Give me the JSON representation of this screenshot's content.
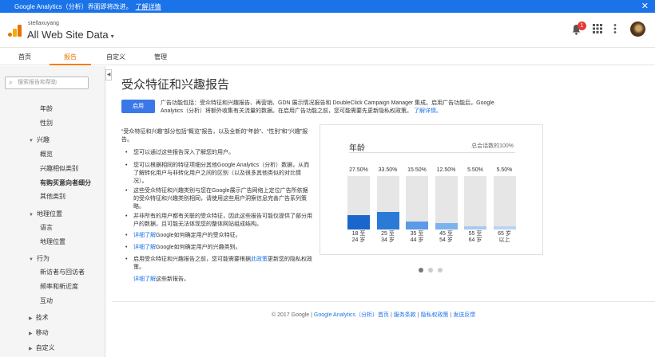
{
  "banner": {
    "text": "Google Analytics（分析）界面即将改进。",
    "link": "了解详情",
    "close": "✕"
  },
  "header": {
    "account": "stellaxuyang",
    "property": "All Web Site Data",
    "property_caret": "▾",
    "notification_count": "1",
    "icons": {
      "bell": "bell-icon",
      "apps": "apps-grid-icon",
      "more": "more-vert-icon"
    }
  },
  "tabs": [
    {
      "label": "首页"
    },
    {
      "label": "报告"
    },
    {
      "label": "自定义"
    },
    {
      "label": "管理"
    }
  ],
  "sidebar": {
    "search_placeholder": "搜索报告和帮助",
    "items": [
      {
        "label": "年龄"
      },
      {
        "label": "性别"
      },
      {
        "label": "兴趣"
      },
      {
        "label": "概览"
      },
      {
        "label": "兴趣相似类别"
      },
      {
        "label": "有购买意向者细分"
      },
      {
        "label": "其他类别"
      },
      {
        "label": "地理位置"
      },
      {
        "label": "语言"
      },
      {
        "label": "地理位置"
      },
      {
        "label": "行为"
      },
      {
        "label": "新访者与回访者"
      },
      {
        "label": "频率和新近度"
      },
      {
        "label": "互动"
      },
      {
        "label": "技术"
      },
      {
        "label": "移动"
      },
      {
        "label": "自定义"
      }
    ]
  },
  "main": {
    "title": "受众特征和兴趣报告",
    "enable_button": "启用",
    "ad_text_line1": "广告功能包括：受众特征和兴趣报告、再营销、GDN 展示情况报告和 DoubleClick Campaign Manager 集成。启用广告功能后，Google",
    "ad_text_line2": "Analytics（分析）将额外收集有关流量的数据。在启用广告功能之前，您可能需要先更新隐私权政策。",
    "ad_link": "了解详情。",
    "intro": "“受众特征和兴趣”部分包括“概览”报告，以及全新的“年龄”、“性别”和“兴趣”报告。",
    "bullets": [
      {
        "text": "您可以通过这些报告深入了解您的用户。"
      },
      {
        "text": "您可以根据相同的特征项细分其他Google Analytics（分析）数据，从而了解转化用户与非转化用户之间的区别（以及很多其他类似的对比情况）。"
      },
      {
        "text": "这些受众特征和兴趣类别与您在Google展示广告网络上定位广告所依据的受众特征和兴趣类别相同，请使用这些用户洞察信息完善广告系列策略。"
      },
      {
        "text": "并非所有的用户都有关联的受众特征，因此这些报告可能仅提供了部分用户的数据，且可能无法体现您的整体网站组成结构。"
      },
      {
        "link": "详细了解",
        "text": "Google如何确定用户的受众特征。"
      },
      {
        "link": "详细了解",
        "text": "Google如何确定用户的兴趣类别。"
      },
      {
        "text_before": "启用受众特征和兴趣报告之前，您可能需要根据",
        "link": "此政策",
        "text_after": "更新您的隐私权政策。"
      }
    ],
    "last_link": "详细了解",
    "last_text": "这些新报告。"
  },
  "chart_data": {
    "type": "bar",
    "title": "年龄",
    "subtitle": "总会话数的100%",
    "categories": [
      "18 至 24 岁",
      "25 至 34 岁",
      "35 至 44 岁",
      "45 至 54 岁",
      "55 至 64 岁",
      "65 岁以上"
    ],
    "category_lines": [
      [
        "18 至",
        "24 岁"
      ],
      [
        "25 至",
        "34 岁"
      ],
      [
        "35 至",
        "44 岁"
      ],
      [
        "45 至",
        "54 岁"
      ],
      [
        "55 至",
        "64 岁"
      ],
      [
        "65 岁",
        "以上"
      ]
    ],
    "value_labels": [
      "27.50%",
      "33.50%",
      "15.50%",
      "12.50%",
      "5.50%",
      "5.50%"
    ],
    "values": [
      27.5,
      33.5,
      15.5,
      12.5,
      5.5,
      5.5
    ],
    "ylim": [
      0,
      100
    ],
    "colors": [
      "#1a66cc",
      "#2b7bd6",
      "#5a9ae6",
      "#7eb2ee",
      "#a6c9f3",
      "#b9d5f5"
    ]
  },
  "carousel": {
    "pages": 3,
    "current": 1
  },
  "footer": {
    "copyright": "© 2017 Google | ",
    "links": [
      "Google Analytics（分析）首页",
      "服务条款",
      "隐私权政策",
      "发送反馈"
    ],
    "separator": " | "
  }
}
